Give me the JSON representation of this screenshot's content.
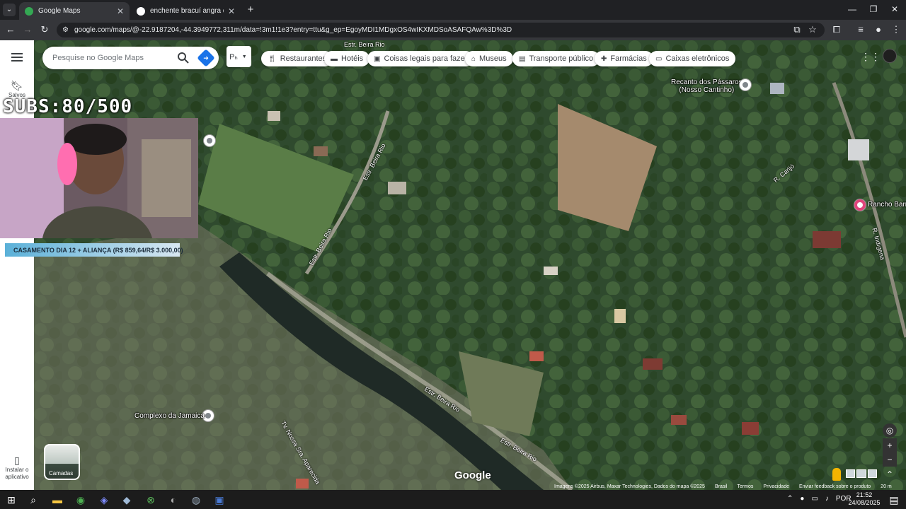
{
  "browser": {
    "tabs": [
      {
        "title": "Google Maps",
        "active": true,
        "favicon_color": "#34a853"
      },
      {
        "title": "enchente bracuí angra dos reis",
        "active": false,
        "favicon_color": "#ffffff"
      }
    ],
    "url": "google.com/maps/@-22.9187204,-44.3949772,311m/data=!3m1!1e3?entry=ttu&g_ep=EgoyMDI1MDgxOS4wIKXMDSoASAFQAw%3D%3D"
  },
  "maps": {
    "search_placeholder": "Pesquise no Google Maps",
    "pt_button": "Pₕ",
    "sidebar": {
      "saved_label": "Salvos",
      "install_label": "Instalar o aplicativo"
    },
    "chips": [
      {
        "label": "Restaurantes",
        "icon": "fork-knife-icon"
      },
      {
        "label": "Hotéis",
        "icon": "bed-icon"
      },
      {
        "label": "Coisas legais para fazer",
        "icon": "camera-icon"
      },
      {
        "label": "Museus",
        "icon": "museum-icon"
      },
      {
        "label": "Transporte público",
        "icon": "bus-icon"
      },
      {
        "label": "Farmácias",
        "icon": "pharmacy-icon"
      },
      {
        "label": "Caixas eletrônicos",
        "icon": "atm-icon"
      }
    ],
    "places": {
      "recanto": "Recanto dos Pássaros\n(Nosso Cantinho)",
      "rancho": "Rancho Barre",
      "complexo": "Complexo da Jamaica"
    },
    "roads": {
      "beira_rio_1": "Estr. Beira Rio",
      "beira_rio_2": "Estr. Beira Rio",
      "beira_rio_3": "Estr. Beira Rio",
      "beira_rio_4": "Estr. Beira Rio",
      "beira_rio_5": "Estr. Beira Rio",
      "carijo": "R. Carijó",
      "indigena": "R. Indígena",
      "nossa_senhora": "Tv. Nossa Sra. Aparecida"
    },
    "layers_label": "Camadas",
    "google_logo": "Google",
    "attribution": "Imagens ©2025 Airbus, Maxar Technologies, Dados do mapa ©2025",
    "footer_links": [
      "Brasil",
      "Termos",
      "Privacidade",
      "Enviar feedback sobre o produto"
    ],
    "scale": "20 m"
  },
  "stream_overlay": {
    "subs": "SUBS:80/500",
    "banner": "CASAMENTO DIA 12 + ALIANÇA (R$ 859,64/R$ 3.000,00)"
  },
  "taskbar": {
    "time": "21:52",
    "date": "24/08/2025",
    "language": "POR"
  }
}
